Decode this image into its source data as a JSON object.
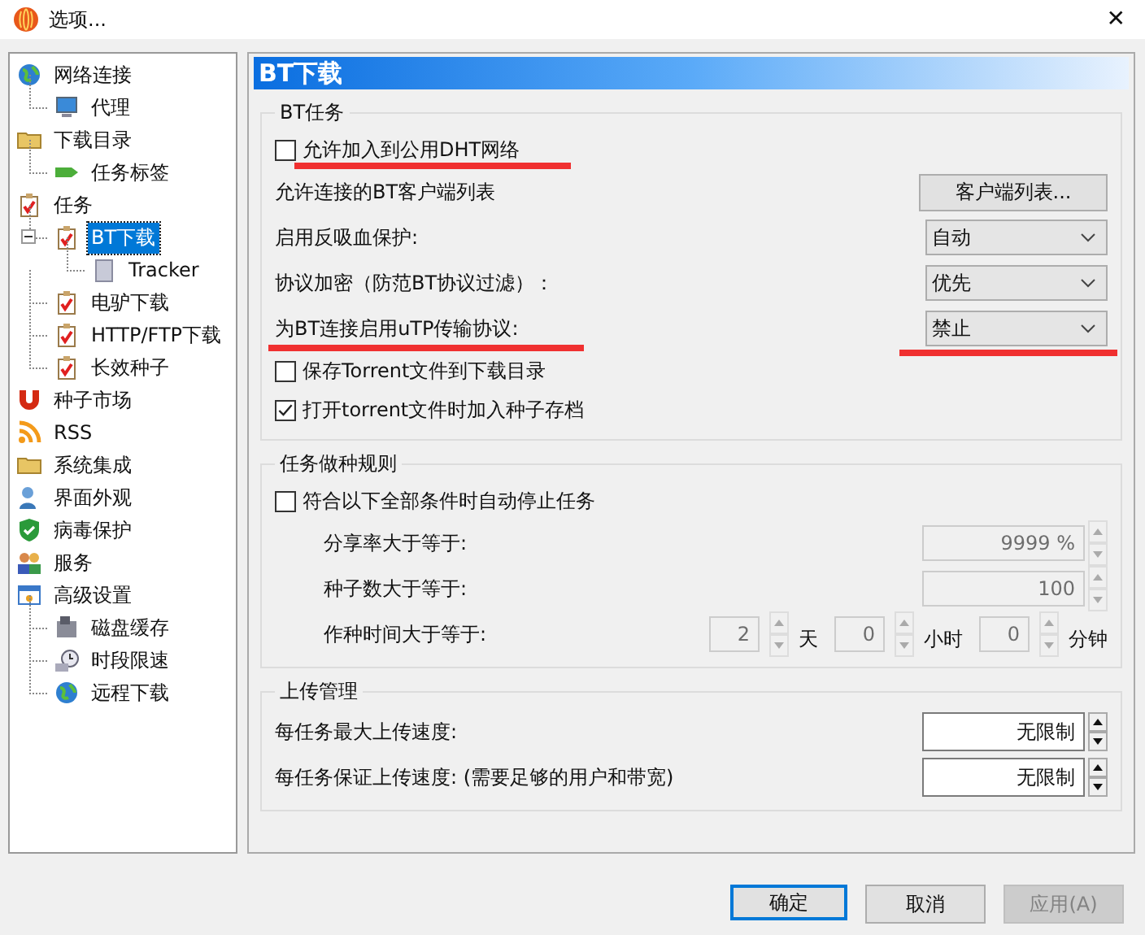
{
  "window": {
    "title": "选项...",
    "close": "✕"
  },
  "sidebar": {
    "items": [
      {
        "label": "网络连接",
        "selected": false,
        "children": [
          {
            "label": "代理",
            "selected": false
          }
        ]
      },
      {
        "label": "下载目录",
        "selected": false,
        "children": [
          {
            "label": "任务标签",
            "selected": false
          }
        ]
      },
      {
        "label": "任务",
        "selected": false,
        "children": [
          {
            "label": "BT下载",
            "selected": true,
            "expanded": true,
            "children": [
              {
                "label": "Tracker",
                "selected": false
              }
            ]
          },
          {
            "label": "电驴下载",
            "selected": false
          },
          {
            "label": "HTTP/FTP下载",
            "selected": false
          },
          {
            "label": "长效种子",
            "selected": false
          }
        ]
      },
      {
        "label": "种子市场",
        "selected": false
      },
      {
        "label": "RSS",
        "selected": false
      },
      {
        "label": "系统集成",
        "selected": false
      },
      {
        "label": "界面外观",
        "selected": false
      },
      {
        "label": "病毒保护",
        "selected": false
      },
      {
        "label": "服务",
        "selected": false
      },
      {
        "label": "高级设置",
        "selected": false,
        "children": [
          {
            "label": "磁盘缓存",
            "selected": false
          },
          {
            "label": "时段限速",
            "selected": false
          },
          {
            "label": "远程下载",
            "selected": false
          }
        ]
      }
    ]
  },
  "page": {
    "title": "BT下载",
    "bt_group": {
      "title": "BT任务",
      "rows": [
        {
          "kind": "checkbox",
          "label": "允许加入到公用DHT网络",
          "checked": false,
          "marked": true
        },
        {
          "kind": "button",
          "label": "允许连接的BT客户端列表",
          "button": "客户端列表...",
          "marked": false
        },
        {
          "kind": "select",
          "label": "启用反吸血保护:",
          "value": "自动",
          "marked": false
        },
        {
          "kind": "select",
          "label": "协议加密（防范BT协议过滤）：",
          "value": "优先",
          "marked": false
        },
        {
          "kind": "select",
          "label": "为BT连接启用uTP传输协议:",
          "value": "禁止",
          "marked": true
        },
        {
          "kind": "checkbox",
          "label": "保存Torrent文件到下载目录",
          "checked": false,
          "marked": false
        },
        {
          "kind": "checkbox",
          "label": "打开torrent文件时加入种子存档",
          "checked": true,
          "marked": false
        }
      ]
    },
    "seed_group": {
      "title": "任务做种规则",
      "checkbox": {
        "label": "符合以下全部条件时自动停止任务",
        "checked": false
      },
      "disabled": true,
      "rows": [
        {
          "label": "分享率大于等于:",
          "value": "9999 %"
        },
        {
          "label": "种子数大于等于:",
          "value": "100"
        }
      ],
      "time": {
        "label": "作种时间大于等于:",
        "parts": [
          {
            "value": "2",
            "unit": "天"
          },
          {
            "value": "0",
            "unit": "小时"
          },
          {
            "value": "0",
            "unit": "分钟"
          }
        ]
      }
    },
    "upload_group": {
      "title": "上传管理",
      "rows": [
        {
          "label": "每任务最大上传速度:",
          "value": "无限制"
        },
        {
          "label": "每任务保证上传速度:  (需要足够的用户和带宽)",
          "value": "无限制"
        }
      ]
    }
  },
  "buttons": [
    {
      "label": "确定",
      "default": true,
      "disabled": false
    },
    {
      "label": "取消",
      "default": false,
      "disabled": false
    },
    {
      "label": "应用(A)",
      "default": false,
      "disabled": true
    }
  ]
}
